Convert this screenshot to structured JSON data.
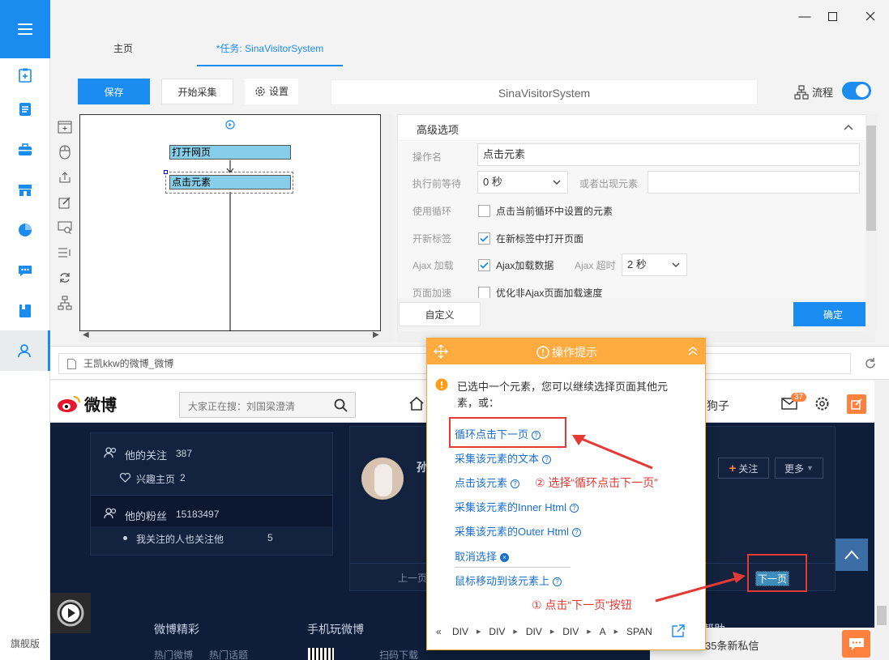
{
  "rail": {
    "edition": "旗舰版"
  },
  "tabs": [
    {
      "label": "主页"
    },
    {
      "label": "*任务: SinaVisitorSystem"
    }
  ],
  "toolbar": {
    "save": "保存",
    "start": "开始采集",
    "settings": "设置",
    "task_name": "SinaVisitorSystem",
    "flow_label": "流程"
  },
  "flow": {
    "node1": "打开网页",
    "node2": "点击元素"
  },
  "advanced": {
    "title": "高级选项",
    "op_name_label": "操作名",
    "op_name_value": "点击元素",
    "wait_label": "执行前等待",
    "wait_value": "0 秒",
    "or_appear_label": "或者出现元素",
    "loop_label": "使用循环",
    "loop_text": "点击当前循环中设置的元素",
    "newtab_label": "开新标签",
    "newtab_text": "在新标签中打开页面",
    "ajax_label": "Ajax 加载",
    "ajax_text": "Ajax加载数据",
    "ajax_timeout_label": "Ajax 超时",
    "ajax_timeout_value": "2 秒",
    "speed_label": "页面加速",
    "speed_text": "优化非Ajax页面加载速度",
    "custom_btn": "自定义",
    "ok_btn": "确定"
  },
  "browser": {
    "url_title": "王凯kkw的微博_微博"
  },
  "weibo": {
    "logo": "微博",
    "search_placeholder": "大家正在搜：刘国梁澄清",
    "username_partial": "糖的狗子",
    "badge_count": "37",
    "follow_label": "他的关注",
    "follow_count": "387",
    "interest_label": "兴趣主页",
    "interest_count": "2",
    "fans_label": "他的粉丝",
    "fans_count": "15183497",
    "common_label": "我关注的人也关注他",
    "common_count": "5",
    "user_initial": "孙",
    "follow_btn": "关注",
    "more_btn": "更多",
    "prev_page": "上一页",
    "next_page": "下一页",
    "footer_col1": "微博精彩",
    "footer_col2": "手机玩微博",
    "footer_col3": "帮助",
    "footer_sub1": "热门微博",
    "footer_sub2": "热门话题",
    "footer_sub3": "扫码下载",
    "msg_text": "35条新私信"
  },
  "popup": {
    "title": "操作提示",
    "message": "已选中一个元素，您可以继续选择页面其他元素，或：",
    "links": [
      "循环点击下一页",
      "采集该元素的文本",
      "点击该元素",
      "采集该元素的Inner Html",
      "采集该元素的Outer Html",
      "取消选择",
      "鼠标移动到该元素上"
    ],
    "breadcrumb": [
      "DIV",
      "DIV",
      "DIV",
      "DIV",
      "A",
      "SPAN"
    ]
  },
  "annotations": {
    "step2": "② 选择“循环点击下一页”",
    "step1": "① 点击“下一页”按钮"
  }
}
